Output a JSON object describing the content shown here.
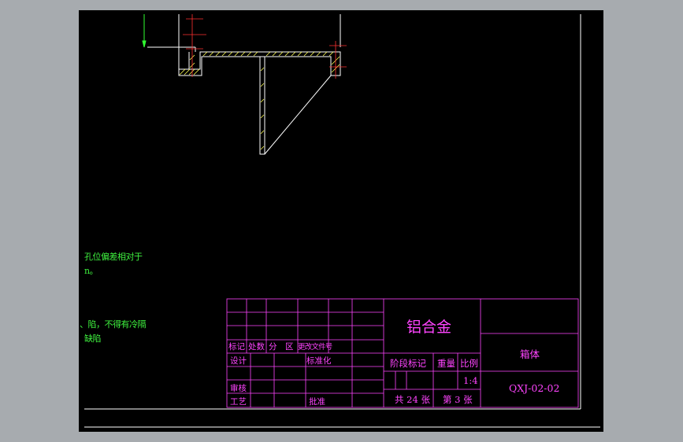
{
  "notes": {
    "line1": "孔位偏差相对于",
    "line2": "n。",
    "line3": "陷，不得有冷隔、",
    "line4": "缺陷。"
  },
  "title_block": {
    "material": "铝合金",
    "part_name": "箱体",
    "drawing_no": "QXJ-02-02",
    "rev_headers": [
      "标记",
      "处数",
      "分　区",
      "更改文件号"
    ],
    "design_label": "设计",
    "standardization_label": "标准化",
    "review_label": "审核",
    "process_label": "工艺",
    "approve_label": "批准",
    "stage_label": "阶段标记",
    "weight_label": "重量",
    "scale_label": "比例",
    "scale_value": "1:4",
    "total_sheets": "共 24 张",
    "sheet_no": "第 3 张"
  },
  "colors": {
    "background": "#000000",
    "viewport": "#a7abaf",
    "frame": "#ffffff",
    "title_block": "#ff44ff",
    "geometry": "#ffffff",
    "hatch": "#ffff55",
    "center_lines": "#ff3030",
    "dimension": "#30ff30"
  }
}
